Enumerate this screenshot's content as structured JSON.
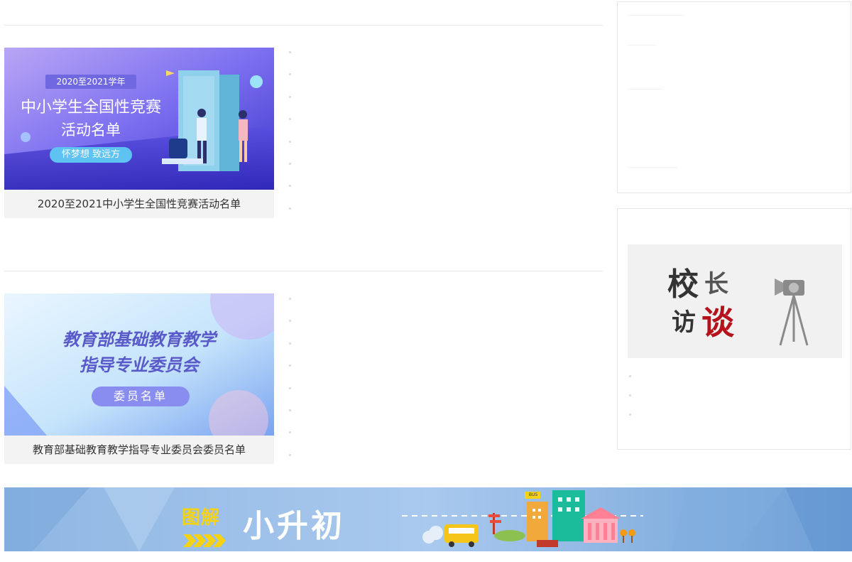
{
  "cards": [
    {
      "image": {
        "year_badge": "2020至2021学年",
        "title_line1": "中小学生全国性竞赛",
        "title_line2": "活动名单",
        "slogan": "怀梦想 致远方"
      },
      "caption": "2020至2021中小学生全国性竞赛活动名单"
    },
    {
      "image": {
        "title_line1": "教育部基础教育教学",
        "title_line2": "指导专业委员会",
        "pill": "委员名单"
      },
      "caption": "教育部基础教育教学指导专业委员会委员名单"
    }
  ],
  "sidebar": {
    "interview_banner": {
      "chars": [
        "校",
        "长",
        "访",
        "谈"
      ],
      "accent_color": "#b5121b"
    }
  },
  "bottom_banner": {
    "tag": "图解",
    "title": "小升初",
    "bus_sign": "BUS"
  },
  "colors": {
    "card1_gradient": [
      "#a78bfa",
      "#6366f1",
      "#4338ca"
    ],
    "banner_bg": "#7aa7d9",
    "tag_yellow": "#f5d312"
  }
}
